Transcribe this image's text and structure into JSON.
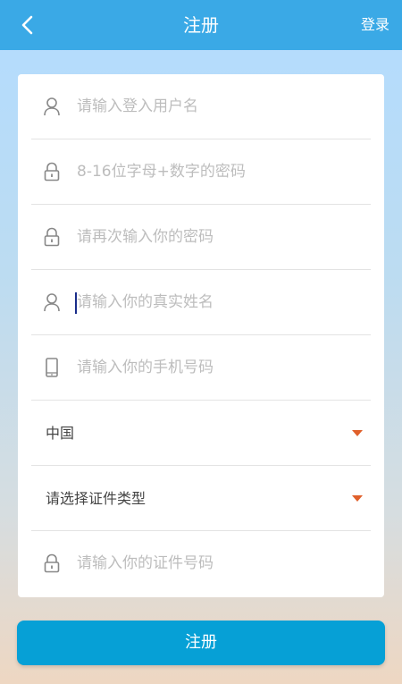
{
  "header": {
    "title": "注册",
    "login_label": "登录",
    "back_icon": "chevron-left-icon"
  },
  "form": {
    "username": {
      "placeholder": "请输入登入用户名",
      "icon": "user-icon"
    },
    "password": {
      "placeholder": "8-16位字母+数字的密码",
      "icon": "lock-icon"
    },
    "password_confirm": {
      "placeholder": "请再次输入你的密码",
      "icon": "lock-icon"
    },
    "real_name": {
      "placeholder": "请输入你的真实姓名",
      "icon": "user-icon"
    },
    "phone": {
      "placeholder": "请输入你的手机号码",
      "icon": "phone-icon"
    },
    "country": {
      "value": "中国",
      "icon": "caret-down-icon"
    },
    "id_type": {
      "value": "请选择证件类型",
      "icon": "caret-down-icon"
    },
    "id_number": {
      "placeholder": "请输入你的证件号码",
      "icon": "lock-icon"
    }
  },
  "submit_label": "注册",
  "colors": {
    "header": "#3aa9e6",
    "button": "#06a0d6",
    "caret": "#e0602b",
    "placeholder": "#bdbdbd"
  }
}
